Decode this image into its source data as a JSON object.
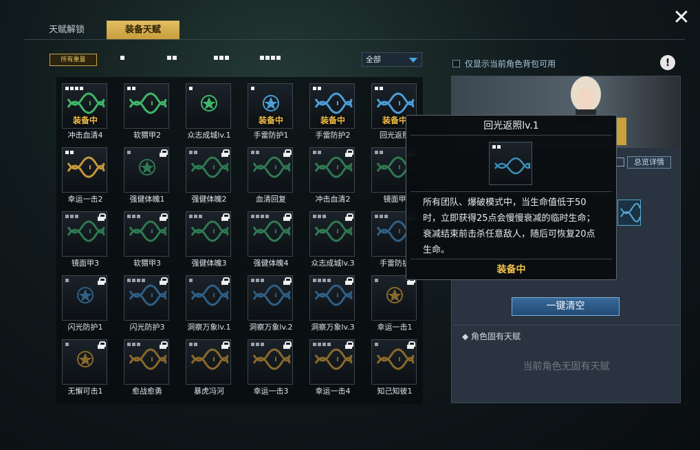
{
  "tabs": [
    {
      "label": "天赋解锁",
      "active": false
    },
    {
      "label": "装备天赋",
      "active": true
    }
  ],
  "filter": {
    "all_label": "所有重量",
    "dot_levels": [
      1,
      2,
      3,
      4
    ],
    "dropdown_value": "全部"
  },
  "equip_tag": "装备中",
  "cards": [
    {
      "label": "冲击血清4",
      "level": 4,
      "locked": false,
      "equipped": true,
      "color": "#3fb86a",
      "icon": "dna-icon"
    },
    {
      "label": "软猬甲2",
      "level": 2,
      "locked": false,
      "equipped": false,
      "color": "#3fb86a",
      "icon": "dna-icon"
    },
    {
      "label": "众志成城lv.1",
      "level": 1,
      "locked": false,
      "equipped": false,
      "color": "#3fb86a",
      "icon": "star-badge-icon"
    },
    {
      "label": "手雷防护1",
      "level": 1,
      "locked": false,
      "equipped": true,
      "color": "#4a9fd8",
      "icon": "star-badge-icon"
    },
    {
      "label": "手雷防护2",
      "level": 2,
      "locked": false,
      "equipped": true,
      "color": "#4a9fd8",
      "icon": "dna-icon"
    },
    {
      "label": "回光返照",
      "level": 2,
      "locked": false,
      "equipped": true,
      "color": "#4a9fd8",
      "icon": "dna-icon"
    },
    {
      "label": "幸运一击2",
      "level": 2,
      "locked": false,
      "equipped": false,
      "color": "#c99a3a",
      "icon": "dna-icon"
    },
    {
      "label": "强健体魄1",
      "level": 1,
      "locked": true,
      "equipped": false,
      "color": "#2f7a52",
      "icon": "star-badge-icon"
    },
    {
      "label": "强健体魄2",
      "level": 2,
      "locked": true,
      "equipped": false,
      "color": "#2f7a52",
      "icon": "dna-icon"
    },
    {
      "label": "血清回复",
      "level": 2,
      "locked": true,
      "equipped": false,
      "color": "#2f7a52",
      "icon": "dna-icon"
    },
    {
      "label": "冲击血清2",
      "level": 2,
      "locked": true,
      "equipped": false,
      "color": "#2f7a52",
      "icon": "dna-icon"
    },
    {
      "label": "镜面甲",
      "level": 2,
      "locked": true,
      "equipped": false,
      "color": "#2f7a52",
      "icon": "dna-icon"
    },
    {
      "label": "镜面甲3",
      "level": 3,
      "locked": true,
      "equipped": false,
      "color": "#2f7a52",
      "icon": "dna-icon"
    },
    {
      "label": "软猬甲3",
      "level": 3,
      "locked": true,
      "equipped": false,
      "color": "#2f7a52",
      "icon": "dna-icon"
    },
    {
      "label": "强健体魄3",
      "level": 3,
      "locked": true,
      "equipped": false,
      "color": "#2f7a52",
      "icon": "dna-icon"
    },
    {
      "label": "强健体魄4",
      "level": 4,
      "locked": true,
      "equipped": false,
      "color": "#2f7a52",
      "icon": "dna-icon"
    },
    {
      "label": "众志成城lv.3",
      "level": 3,
      "locked": true,
      "equipped": false,
      "color": "#2f7a52",
      "icon": "dna-icon"
    },
    {
      "label": "手雷防护",
      "level": 3,
      "locked": true,
      "equipped": false,
      "color": "#2f5f86",
      "icon": "dna-icon"
    },
    {
      "label": "闪光防护1",
      "level": 1,
      "locked": true,
      "equipped": false,
      "color": "#2f5f86",
      "icon": "star-badge-icon"
    },
    {
      "label": "闪光防护3",
      "level": 4,
      "locked": true,
      "equipped": false,
      "color": "#2f5f86",
      "icon": "dna-icon"
    },
    {
      "label": "洞察万象lv.1",
      "level": 1,
      "locked": true,
      "equipped": false,
      "color": "#2f5f86",
      "icon": "dna-icon"
    },
    {
      "label": "洞察万象lv.2",
      "level": 3,
      "locked": true,
      "equipped": false,
      "color": "#2f5f86",
      "icon": "dna-icon"
    },
    {
      "label": "洞察万象lv.3",
      "level": 4,
      "locked": true,
      "equipped": false,
      "color": "#2f5f86",
      "icon": "dna-icon"
    },
    {
      "label": "幸运一击1",
      "level": 1,
      "locked": true,
      "equipped": false,
      "color": "#8a6a2a",
      "icon": "star-badge-icon"
    },
    {
      "label": "无懈可击1",
      "level": 1,
      "locked": true,
      "equipped": false,
      "color": "#8a6a2a",
      "icon": "star-badge-icon"
    },
    {
      "label": "愈战愈勇",
      "level": 3,
      "locked": true,
      "equipped": false,
      "color": "#8a6a2a",
      "icon": "dna-icon"
    },
    {
      "label": "暴虎冯河",
      "level": 2,
      "locked": true,
      "equipped": false,
      "color": "#8a6a2a",
      "icon": "dna-icon"
    },
    {
      "label": "幸运一击3",
      "level": 3,
      "locked": true,
      "equipped": false,
      "color": "#8a6a2a",
      "icon": "dna-icon"
    },
    {
      "label": "幸运一击4",
      "level": 4,
      "locked": true,
      "equipped": false,
      "color": "#8a6a2a",
      "icon": "dna-icon"
    },
    {
      "label": "知己知彼1",
      "level": 1,
      "locked": true,
      "equipped": false,
      "color": "#8a6a2a",
      "icon": "dna-icon"
    }
  ],
  "right": {
    "checkbox_label": "仅显示当前角色背包可用",
    "info_glyph": "!",
    "detail_label": "总览详情",
    "clear_label": "一键清空",
    "innate_title": "角色固有天赋",
    "innate_empty": "当前角色无固有天赋"
  },
  "tooltip": {
    "title": "回光返照lv.1",
    "level": 2,
    "description": "所有团队、爆破模式中，当生命值低于50时，立即获得25点会慢慢衰减的临时生命；衰减结束前击杀任意敌人，随后可恢复20点生命。",
    "status": "装备中"
  },
  "colors": {
    "accent_gold": "#f3c24a",
    "active_tab": "#d6b050",
    "button_blue": "#2d5a86"
  }
}
